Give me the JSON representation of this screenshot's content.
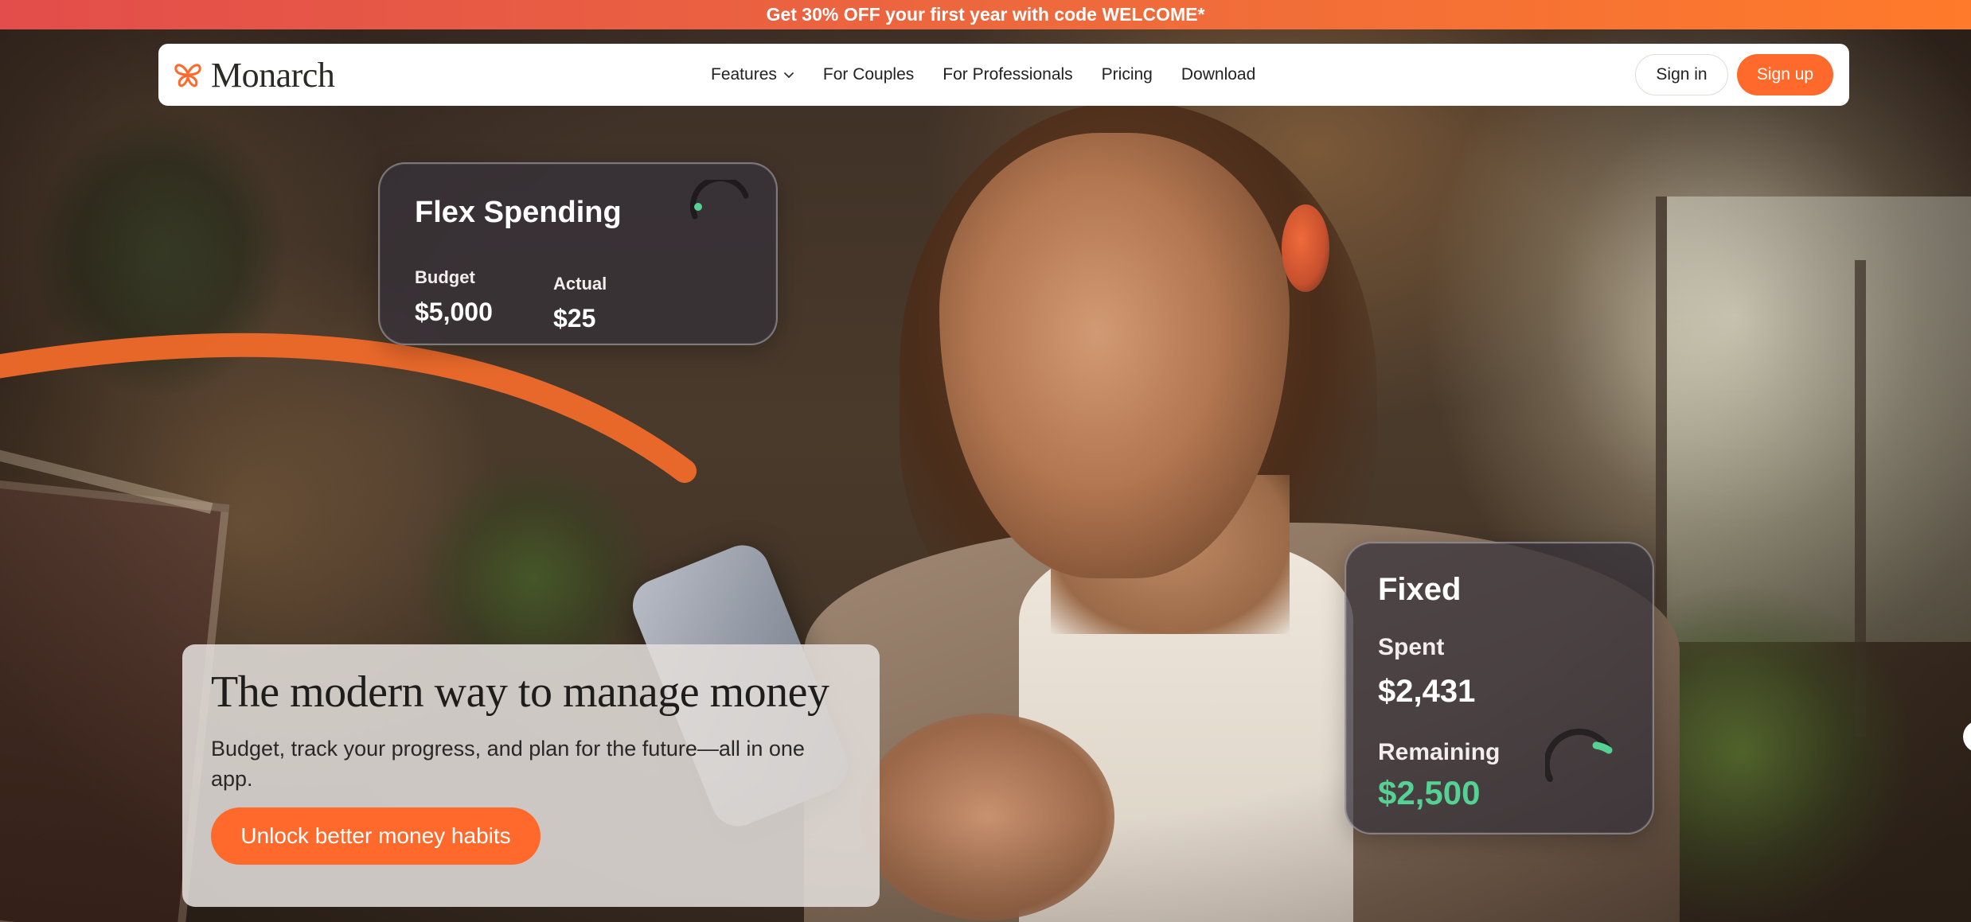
{
  "promo": {
    "text": "Get 30% OFF your first year with code WELCOME*"
  },
  "nav": {
    "logo_text": "Monarch",
    "logo_icon": "butterfly-icon",
    "links": [
      {
        "label": "Features",
        "has_dropdown": true
      },
      {
        "label": "For Couples"
      },
      {
        "label": "For Professionals"
      },
      {
        "label": "Pricing"
      },
      {
        "label": "Download"
      }
    ],
    "signin_label": "Sign in",
    "signup_label": "Sign up"
  },
  "flex_card": {
    "title": "Flex Spending",
    "budget_label": "Budget",
    "budget_value": "$5,000",
    "actual_label": "Actual",
    "actual_value": "$25"
  },
  "fixed_card": {
    "title": "Fixed",
    "spent_label": "Spent",
    "spent_value": "$2,431",
    "remaining_label": "Remaining",
    "remaining_value": "$2,500"
  },
  "hero": {
    "title": "The modern way to manage money",
    "subtitle": "Budget, track your progress, and plan for the future—all in one app.",
    "cta_label": "Unlock better money habits"
  },
  "colors": {
    "accent": "#ff6a2c",
    "positive": "#55d193",
    "promo_start": "#e34d4b",
    "promo_end": "#ff7a2a"
  }
}
